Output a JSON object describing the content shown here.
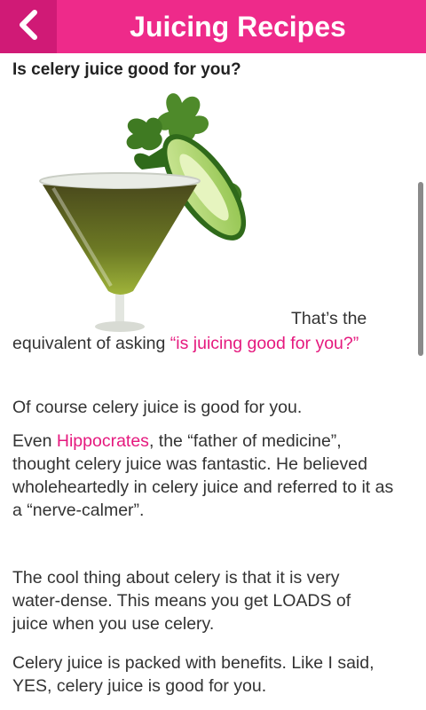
{
  "header": {
    "title": "Juicing Recipes",
    "back_icon": "chevron-left-icon"
  },
  "article": {
    "title": "Is celery juice good for you?",
    "image_alt": "celery juice cocktail with cucumber slice",
    "p1": {
      "pre": "That’s the",
      "line2_pre": "equivalent of asking ",
      "link": "“is juicing good for you?”"
    },
    "p2": "Of course celery juice is good for you.",
    "p3": {
      "pre": "Even ",
      "link": "Hippocrates",
      "post": ", the “father of medicine”, thought celery juice was fantastic. He believed wholeheartedly in celery juice and referred to it as a “nerve-calmer”."
    },
    "p4": "The cool thing about celery is that it is very water-dense. This means you get LOADS of juice when you use celery.",
    "p5": "Celery juice is packed with benefits. Like I said, YES, celery juice is good for you."
  },
  "colors": {
    "header_bg": "#ee2a8a",
    "back_bg": "#d01a76",
    "link": "#e5197e"
  }
}
